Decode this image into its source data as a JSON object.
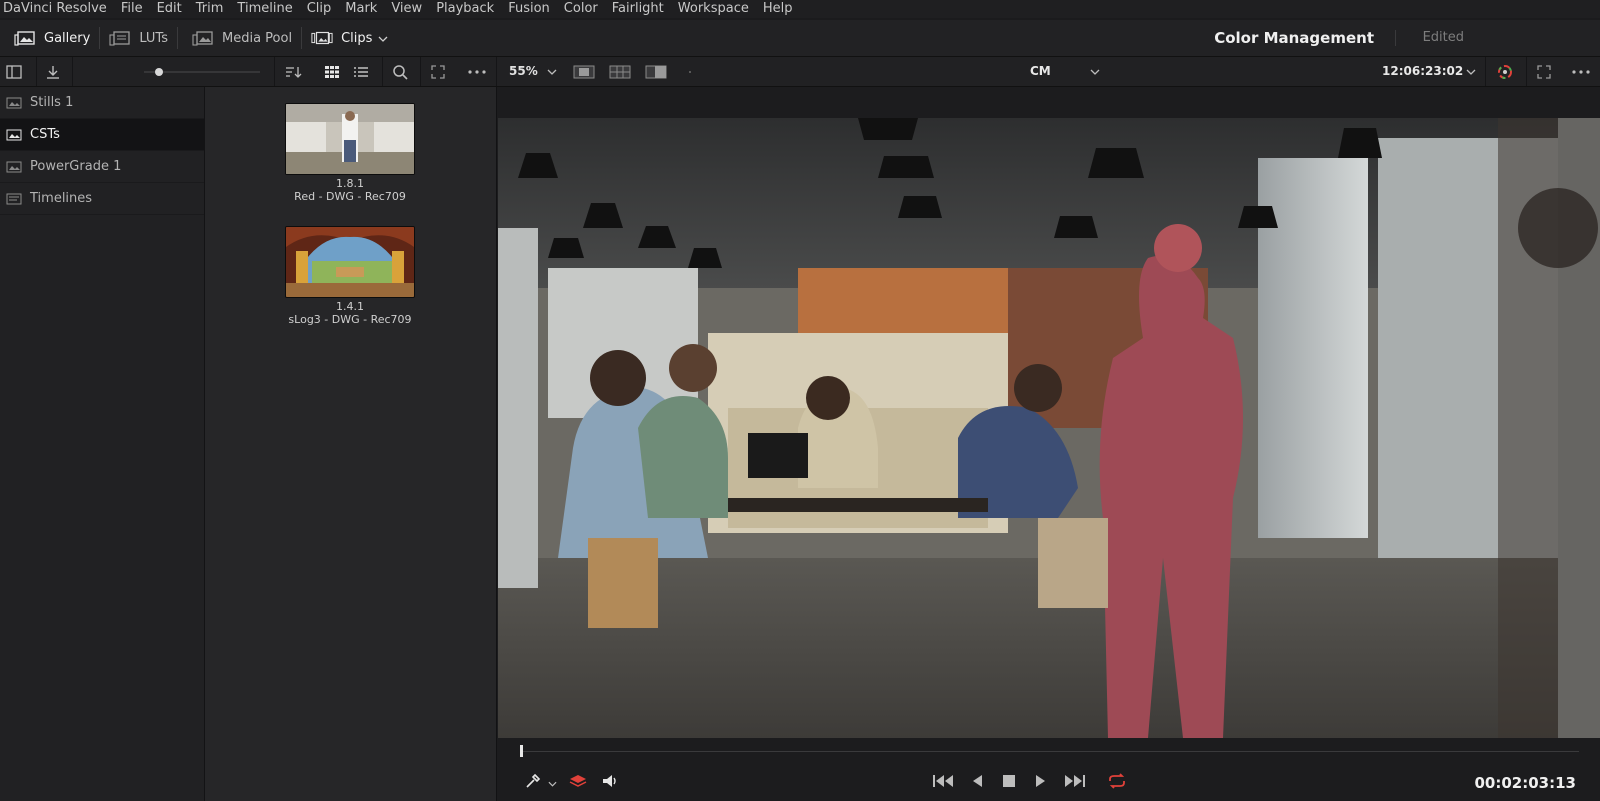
{
  "menubar": {
    "items": [
      "DaVinci Resolve",
      "File",
      "Edit",
      "Trim",
      "Timeline",
      "Clip",
      "Mark",
      "View",
      "Playback",
      "Fusion",
      "Color",
      "Fairlight",
      "Workspace",
      "Help"
    ]
  },
  "toolbar": {
    "gallery_label": "Gallery",
    "luts_label": "LUTs",
    "mediapool_label": "Media Pool",
    "clips_label": "Clips",
    "page_title": "Color Management",
    "status": "Edited"
  },
  "viewer_bar": {
    "zoom": "55%",
    "mode": "CM",
    "timecode": "12:06:23:02"
  },
  "sidebar": {
    "items": [
      {
        "label": "Stills 1"
      },
      {
        "label": "CSTs"
      },
      {
        "label": "PowerGrade 1"
      },
      {
        "label": "Timelines"
      }
    ]
  },
  "gallery": {
    "stills": [
      {
        "number": "1.8.1",
        "label": "Red - DWG - Rec709"
      },
      {
        "number": "1.4.1",
        "label": "sLog3 - DWG - Rec709"
      }
    ]
  },
  "transport": {
    "timecode": "00:02:03:13"
  },
  "colors": {
    "accent_red": "#e0413a",
    "panel": "#212123",
    "background": "#1b1b1d"
  }
}
